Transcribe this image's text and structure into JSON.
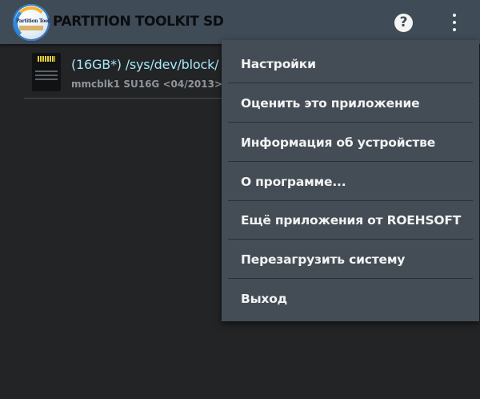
{
  "appbar": {
    "title": "PARTITION TOOLKIT SD",
    "logo_text": "Partition Toolkit",
    "help_icon": "help-icon",
    "help_glyph": "?",
    "overflow_icon": "overflow-menu-icon"
  },
  "device_list": {
    "items": [
      {
        "icon": "sd-card-icon",
        "title": "(16GB*) /sys/dev/block/",
        "subtitle": "mmcblk1 SU16G <04/2013>"
      }
    ]
  },
  "menu": {
    "items": [
      {
        "label": "Настройки"
      },
      {
        "label": "Оценить это приложение"
      },
      {
        "label": "Информация об устройстве"
      },
      {
        "label": "О программе..."
      },
      {
        "label": "Ещё приложения от ROEHSOFT"
      },
      {
        "label": "Перезагрузить систему"
      },
      {
        "label": "Выход"
      }
    ]
  },
  "colors": {
    "appbar_bg": "#3f4b56",
    "background": "#222426",
    "menu_bg": "#444d55",
    "device_title": "#a9e7f7",
    "device_subtitle": "#8f959a"
  }
}
